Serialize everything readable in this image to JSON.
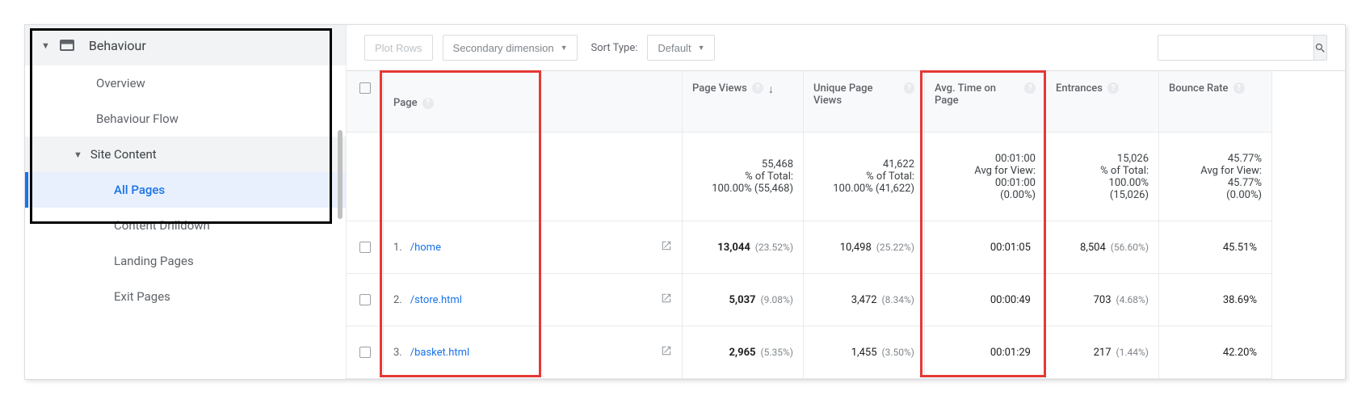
{
  "sidebar": {
    "section_label": "Behaviour",
    "items": {
      "overview": "Overview",
      "behaviour_flow": "Behaviour Flow",
      "site_content": "Site Content",
      "all_pages": "All Pages",
      "content_drilldown": "Content Drilldown",
      "landing_pages": "Landing Pages",
      "exit_pages": "Exit Pages"
    }
  },
  "toolbar": {
    "plot_rows": "Plot Rows",
    "secondary_dimension": "Secondary dimension",
    "sort_type_label": "Sort Type:",
    "sort_type_value": "Default"
  },
  "columns": {
    "page": "Page",
    "page_views": "Page Views",
    "unique_page_views": "Unique Page Views",
    "avg_time": "Avg. Time on Page",
    "entrances": "Entrances",
    "bounce_rate": "Bounce Rate"
  },
  "summary": {
    "page_views": {
      "value": "55,468",
      "sub1": "% of Total:",
      "sub2": "100.00% (55,468)"
    },
    "unique": {
      "value": "41,622",
      "sub1": "% of Total:",
      "sub2": "100.00% (41,622)"
    },
    "avg_time": {
      "value": "00:01:00",
      "sub1": "Avg for View:",
      "sub2": "00:01:00",
      "sub3": "(0.00%)"
    },
    "entrances": {
      "value": "15,026",
      "sub1": "% of Total:",
      "sub2": "100.00%",
      "sub3": "(15,026)"
    },
    "bounce": {
      "value": "45.77%",
      "sub1": "Avg for View:",
      "sub2": "45.77%",
      "sub3": "(0.00%)"
    }
  },
  "rows": [
    {
      "n": "1.",
      "page": "/home",
      "pv": "13,044",
      "pv_pct": "(23.52%)",
      "uv": "10,498",
      "uv_pct": "(25.22%)",
      "time": "00:01:05",
      "ent": "8,504",
      "ent_pct": "(56.60%)",
      "br": "45.51%"
    },
    {
      "n": "2.",
      "page": "/store.html",
      "pv": "5,037",
      "pv_pct": "(9.08%)",
      "uv": "3,472",
      "uv_pct": "(8.34%)",
      "time": "00:00:49",
      "ent": "703",
      "ent_pct": "(4.68%)",
      "br": "38.69%"
    },
    {
      "n": "3.",
      "page": "/basket.html",
      "pv": "2,965",
      "pv_pct": "(5.35%)",
      "uv": "1,455",
      "uv_pct": "(3.50%)",
      "time": "00:01:29",
      "ent": "217",
      "ent_pct": "(1.44%)",
      "br": "42.20%"
    }
  ]
}
